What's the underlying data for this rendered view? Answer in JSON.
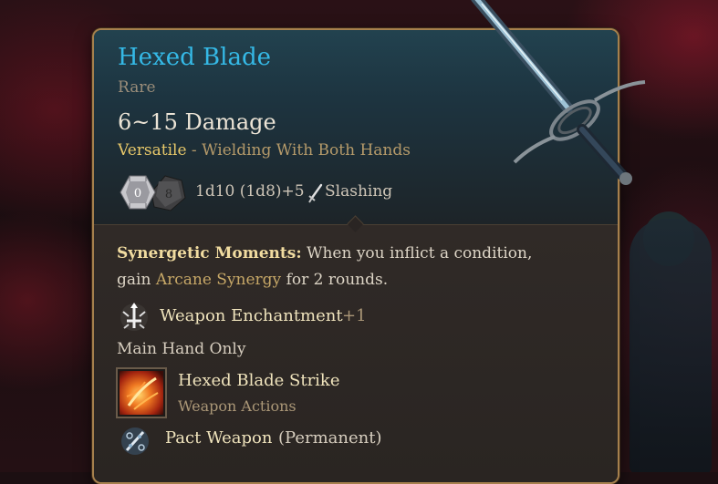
{
  "item": {
    "name": "Hexed Blade",
    "rarity": "Rare",
    "damage": "6~15 Damage",
    "property_keyword": "Versatile",
    "property_separator": " - ",
    "property_text": "Wielding With Both Hands",
    "dice_values": [
      "0",
      "8"
    ],
    "dice_text": "1d10 (1d8)+5",
    "damage_type": "Slashing",
    "damage_type_icon": "sword-slash-icon"
  },
  "synergy": {
    "title": "Synergetic Moments:",
    "line1_rest": " When you inflict a condition,",
    "line2_prefix": "gain ",
    "line2_link": "Arcane Synergy",
    "line2_suffix": " for 2 rounds."
  },
  "enchantment": {
    "label": "Weapon Enchantment",
    "bonus": "+1",
    "icon": "sword-enchant-icon"
  },
  "main_hand_note": "Main Hand Only",
  "action": {
    "name": "Hexed Blade Strike",
    "type": "Weapon Actions",
    "icon": "hexed-strike-icon"
  },
  "pact": {
    "label": "Pact Weapon",
    "status": "(Permanent)",
    "icon": "pact-weapon-icon"
  },
  "colors": {
    "name": "#35b9e6",
    "border": "#a6804d",
    "keyword": "#e8c86a",
    "muted": "#ab9777"
  }
}
